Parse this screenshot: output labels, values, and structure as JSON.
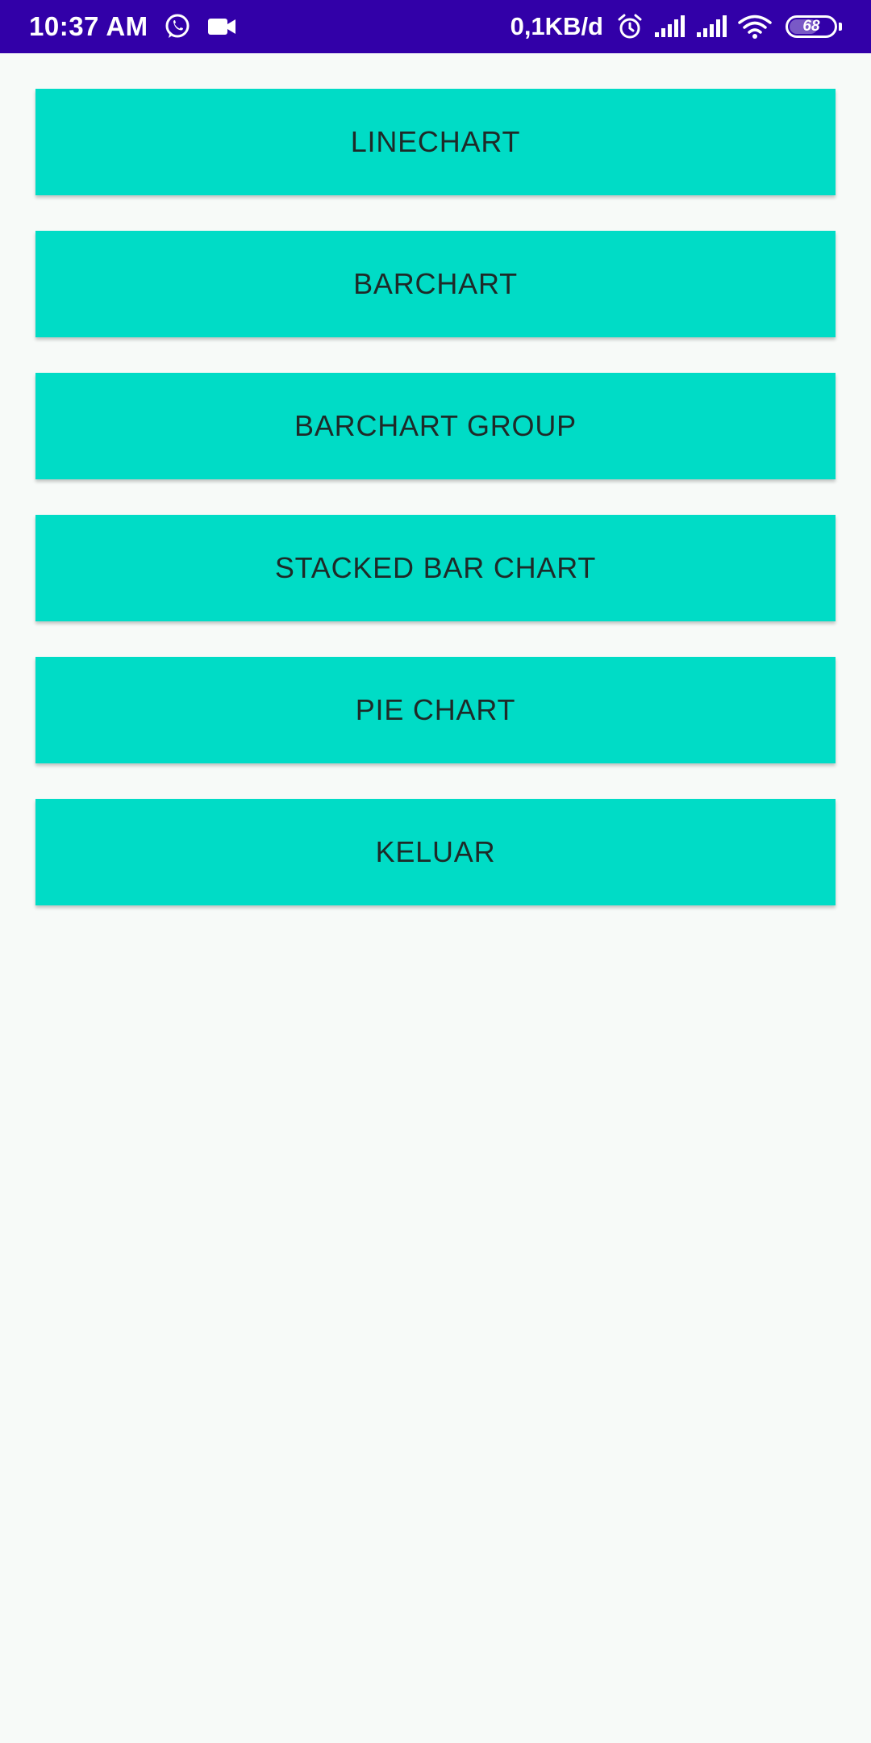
{
  "status_bar": {
    "time": "10:37 AM",
    "net_speed": "0,1KB/d",
    "battery": "68",
    "battery_level": 0.68,
    "notification_icons": [
      "whatsapp-icon",
      "video-camera-icon"
    ],
    "system_icons": [
      "alarm-icon",
      "signal-icon",
      "signal-icon",
      "wifi-icon",
      "battery-icon"
    ],
    "background_color": "#3200a8"
  },
  "menu": {
    "button_color": "#00dcc6",
    "text_color": "#1e2a28",
    "items": [
      {
        "label": "LINECHART"
      },
      {
        "label": "BARCHART"
      },
      {
        "label": "BARCHART GROUP"
      },
      {
        "label": "STACKED BAR CHART"
      },
      {
        "label": "PIE CHART"
      },
      {
        "label": "KELUAR"
      }
    ]
  }
}
